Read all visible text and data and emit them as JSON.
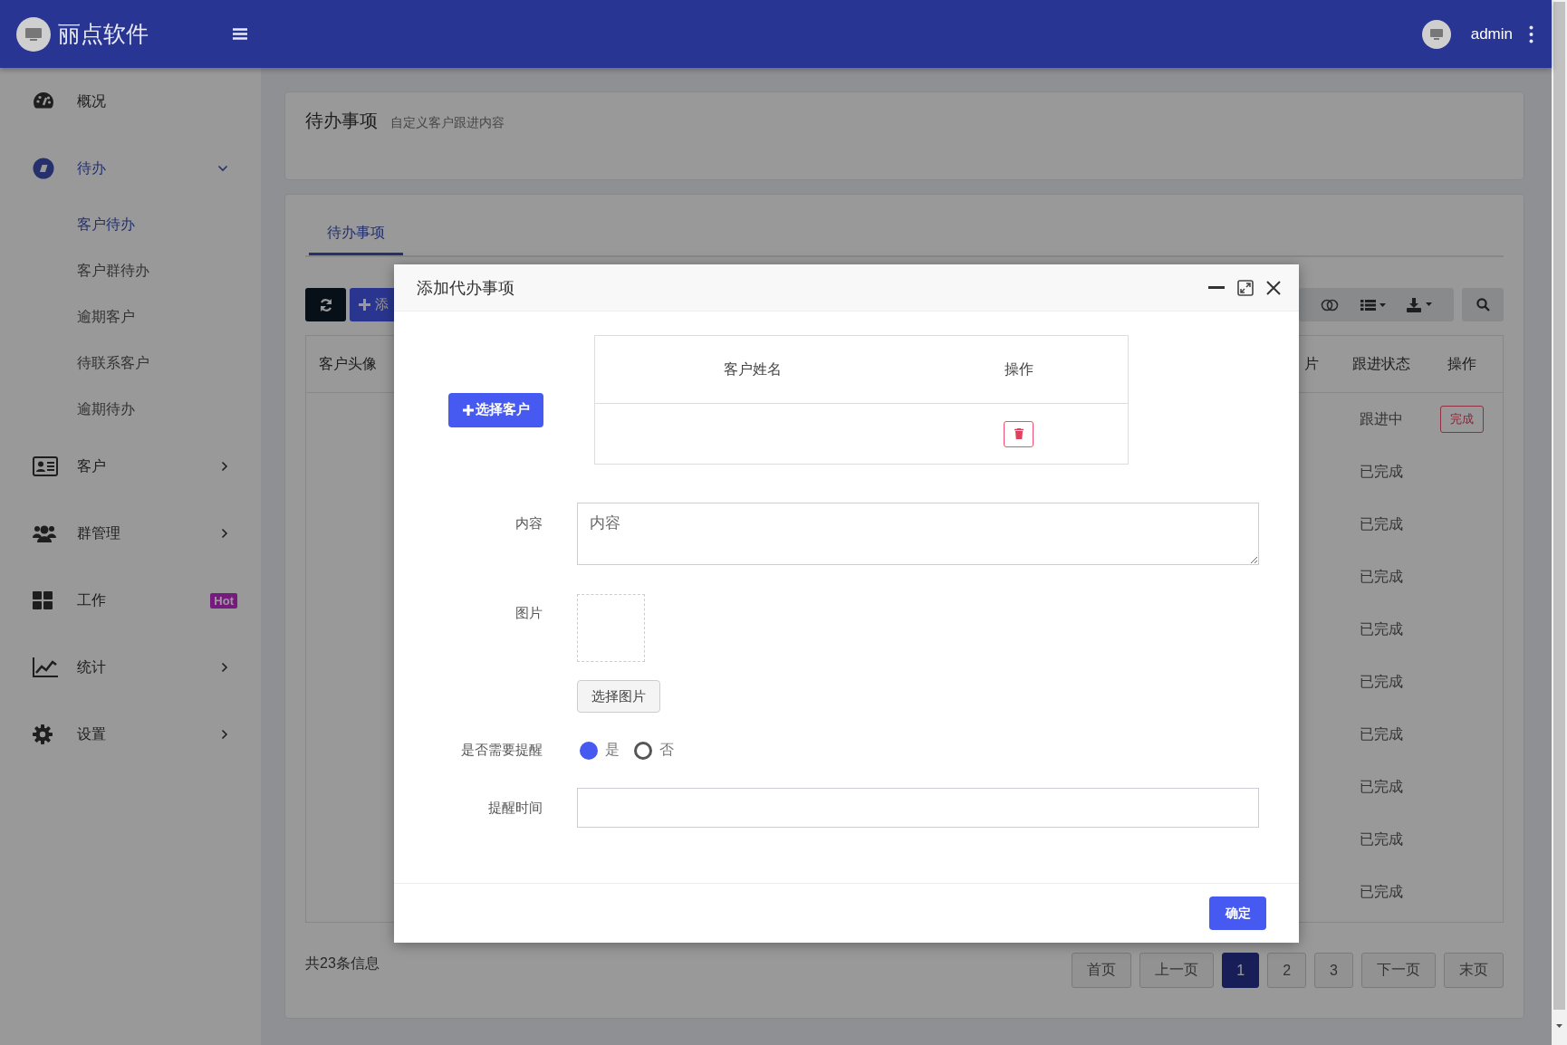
{
  "header": {
    "brand": "丽点软件",
    "user": "admin"
  },
  "sidebar": {
    "items": [
      {
        "label": "概况",
        "kind": "link",
        "selected": false
      },
      {
        "label": "待办",
        "kind": "group",
        "selected": true,
        "expanded": true,
        "children": [
          {
            "label": "客户待办",
            "selected": true
          },
          {
            "label": "客户群待办",
            "selected": false
          },
          {
            "label": "逾期客户",
            "selected": false
          },
          {
            "label": "待联系客户",
            "selected": false
          },
          {
            "label": "逾期待办",
            "selected": false
          }
        ]
      },
      {
        "label": "客户",
        "kind": "group",
        "selected": false,
        "expanded": false
      },
      {
        "label": "群管理",
        "kind": "group",
        "selected": false,
        "expanded": false
      },
      {
        "label": "工作",
        "kind": "link",
        "selected": false,
        "badge": "Hot"
      },
      {
        "label": "统计",
        "kind": "group",
        "selected": false,
        "expanded": false
      },
      {
        "label": "设置",
        "kind": "group",
        "selected": false,
        "expanded": false
      }
    ]
  },
  "page_header": {
    "title": "待办事项",
    "subtitle": "自定义客户跟进内容"
  },
  "tabs": [
    {
      "label": "待办事项",
      "selected": true
    }
  ],
  "toolbar": {
    "add_button": "添"
  },
  "table": {
    "columns": [
      "客户头像",
      "片",
      "跟进状态",
      "操作"
    ],
    "rows": [
      {
        "status": "跟进中",
        "action": "完成"
      },
      {
        "status": "已完成"
      },
      {
        "status": "已完成"
      },
      {
        "status": "已完成"
      },
      {
        "status": "已完成"
      },
      {
        "status": "已完成"
      },
      {
        "status": "已完成"
      },
      {
        "status": "已完成"
      },
      {
        "status": "已完成"
      },
      {
        "status": "已完成"
      }
    ]
  },
  "summary": "共23条信息",
  "pagination": [
    {
      "label": "首页",
      "selected": false
    },
    {
      "label": "上一页",
      "selected": false
    },
    {
      "label": "1",
      "selected": true
    },
    {
      "label": "2",
      "selected": false
    },
    {
      "label": "3",
      "selected": false
    },
    {
      "label": "下一页",
      "selected": false
    },
    {
      "label": "末页",
      "selected": false
    }
  ],
  "dialog": {
    "title": "添加代办事项",
    "select_customer_button": "选择客户",
    "customer_table": {
      "columns": [
        "客户姓名",
        "操作"
      ]
    },
    "fields": [
      {
        "kind": "textarea",
        "label": "内容",
        "placeholder": "内容"
      },
      {
        "kind": "image",
        "label": "图片",
        "button": "选择图片"
      },
      {
        "kind": "radio",
        "label": "是否需要提醒",
        "options": [
          {
            "label": "是",
            "selected": true
          },
          {
            "label": "否",
            "selected": false
          }
        ]
      },
      {
        "kind": "text",
        "label": "提醒时间"
      }
    ],
    "confirm_button": "确定"
  }
}
